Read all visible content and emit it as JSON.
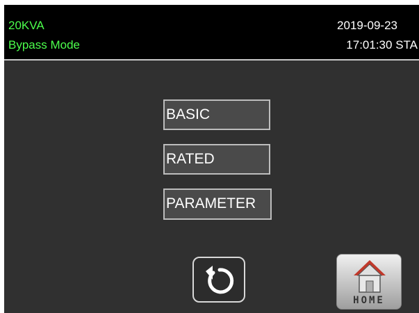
{
  "header": {
    "model": "20KVA",
    "mode": "Bypass Mode",
    "date": "2019-09-23",
    "time": "17:01:30 STA"
  },
  "menu": {
    "basic_label": "BASIC",
    "rated_label": "RATED",
    "parameter_label": "PARAMETER"
  },
  "footer": {
    "back_icon": "refresh-icon",
    "home_label": "HOME",
    "home_icon": "house-icon"
  },
  "colors": {
    "status_text": "#4cff4c",
    "screen_background": "#303030",
    "header_background": "#000000",
    "home_roof": "#c0392b"
  }
}
